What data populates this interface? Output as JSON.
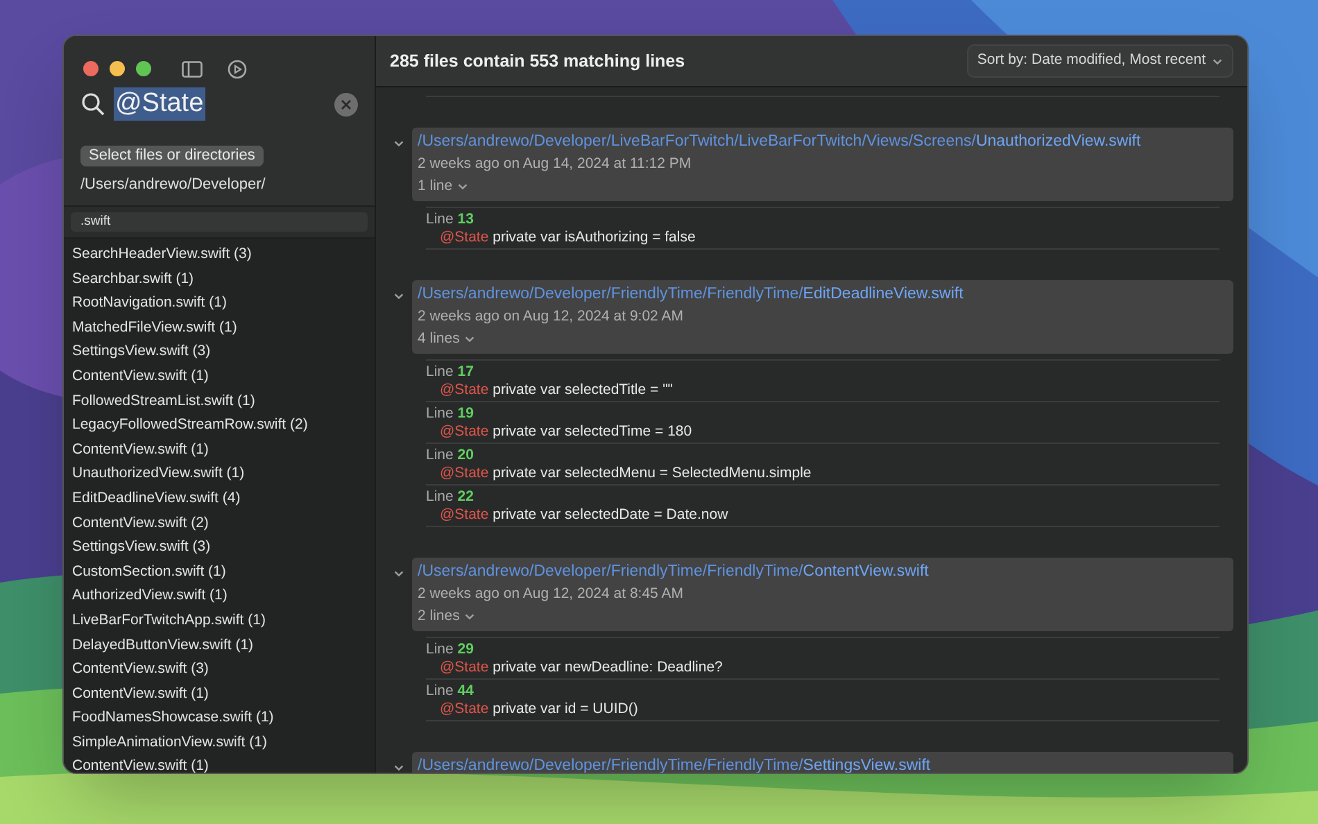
{
  "search": {
    "value": "@State",
    "selected": true
  },
  "select_button": "Select files or directories",
  "path": "/Users/andrewo/Developer/",
  "filter": {
    "value": ".swift"
  },
  "files": [
    "SearchHeaderView.swift (3)",
    "Searchbar.swift (1)",
    "RootNavigation.swift (1)",
    "MatchedFileView.swift (1)",
    "SettingsView.swift (3)",
    "ContentView.swift (1)",
    "FollowedStreamList.swift (1)",
    "LegacyFollowedStreamRow.swift (2)",
    "ContentView.swift (1)",
    "UnauthorizedView.swift (1)",
    "EditDeadlineView.swift (4)",
    "ContentView.swift (2)",
    "SettingsView.swift (3)",
    "CustomSection.swift (1)",
    "AuthorizedView.swift (1)",
    "LiveBarForTwitchApp.swift (1)",
    "DelayedButtonView.swift (1)",
    "ContentView.swift (3)",
    "ContentView.swift (1)",
    "FoodNamesShowcase.swift (1)",
    "SimpleAnimationView.swift (1)",
    "ContentView.swift (1)"
  ],
  "summary": "285 files contain 553 matching lines",
  "sort": "Sort by: Date modified, Most recent",
  "results": [
    {
      "dir": "/Users/andrewo/Developer/LiveBarForTwitch/LiveBarForTwitch/Views/Screens/",
      "file": "UnauthorizedView.swift",
      "date": "2 weeks ago on Aug 14, 2024 at 11:12 PM",
      "count": "1 line",
      "expanded": true,
      "matches": [
        {
          "label": "Line",
          "number": "13",
          "keyword": "@State",
          "code": "private var isAuthorizing = false"
        }
      ]
    },
    {
      "dir": "/Users/andrewo/Developer/FriendlyTime/FriendlyTime/",
      "file": "EditDeadlineView.swift",
      "date": "2 weeks ago on Aug 12, 2024 at 9:02 AM",
      "count": "4 lines",
      "expanded": true,
      "matches": [
        {
          "label": "Line",
          "number": "17",
          "keyword": "@State",
          "code": "private var selectedTitle = \"\""
        },
        {
          "label": "Line",
          "number": "19",
          "keyword": "@State",
          "code": "private var selectedTime = 180"
        },
        {
          "label": "Line",
          "number": "20",
          "keyword": "@State",
          "code": "private var selectedMenu = SelectedMenu.simple"
        },
        {
          "label": "Line",
          "number": "22",
          "keyword": "@State",
          "code": "private var selectedDate = Date.now"
        }
      ]
    },
    {
      "dir": "/Users/andrewo/Developer/FriendlyTime/FriendlyTime/",
      "file": "ContentView.swift",
      "date": "2 weeks ago on Aug 12, 2024 at 8:45 AM",
      "count": "2 lines",
      "expanded": true,
      "matches": [
        {
          "label": "Line",
          "number": "29",
          "keyword": "@State",
          "code": "private var newDeadline: Deadline?"
        },
        {
          "label": "Line",
          "number": "44",
          "keyword": "@State",
          "code": "private var id = UUID()"
        }
      ]
    },
    {
      "dir": "/Users/andrewo/Developer/FriendlyTime/FriendlyTime/",
      "file": "SettingsView.swift"
    }
  ]
}
